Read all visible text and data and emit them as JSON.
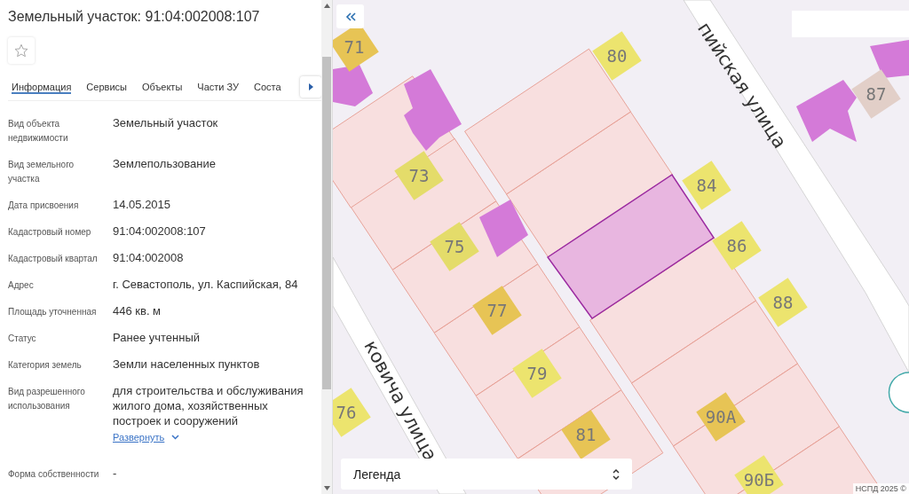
{
  "panel": {
    "title": "Земельный участок: 91:04:002008:107",
    "favorite": false,
    "tabs": [
      {
        "label": "Информация",
        "selected": true
      },
      {
        "label": "Сервисы",
        "selected": false
      },
      {
        "label": "Объекты",
        "selected": false
      },
      {
        "label": "Части ЗУ",
        "selected": false
      },
      {
        "label": "Соста",
        "selected": false
      }
    ],
    "fields": [
      {
        "label": "Вид объекта недвижимости",
        "value": "Земельный участок"
      },
      {
        "label": "Вид земельного участка",
        "value": "Землепользование"
      },
      {
        "label": "Дата присвоения",
        "value": "14.05.2015"
      },
      {
        "label": "Кадастровый номер",
        "value": "91:04:002008:107"
      },
      {
        "label": "Кадастровый квартал",
        "value": "91:04:002008"
      },
      {
        "label": "Адрес",
        "value": "г. Севастополь, ул. Каспийская, 84"
      },
      {
        "label": "Площадь уточненная",
        "value": "446 кв. м"
      },
      {
        "label": "Статус",
        "value": "Ранее учтенный"
      },
      {
        "label": "Категория земель",
        "value": "Земли населенных пунктов"
      },
      {
        "label": "Вид разрешенного использования",
        "value": "для строительства и обслуживания жилого дома, хозяйственных построек и сооружений",
        "expand_link": "Развернуть"
      },
      {
        "label": "Форма собственности",
        "value": "-"
      }
    ]
  },
  "map": {
    "house_numbers": [
      "71",
      "80",
      "87",
      "73",
      "84",
      "86",
      "75",
      "88",
      "77",
      "79",
      "76",
      "90А",
      "81",
      "90Б"
    ],
    "streets": [
      "пийская улица",
      "ковича улица"
    ],
    "legend": {
      "label": "Легенда"
    },
    "attribution": "НСПД 2025 ©"
  }
}
